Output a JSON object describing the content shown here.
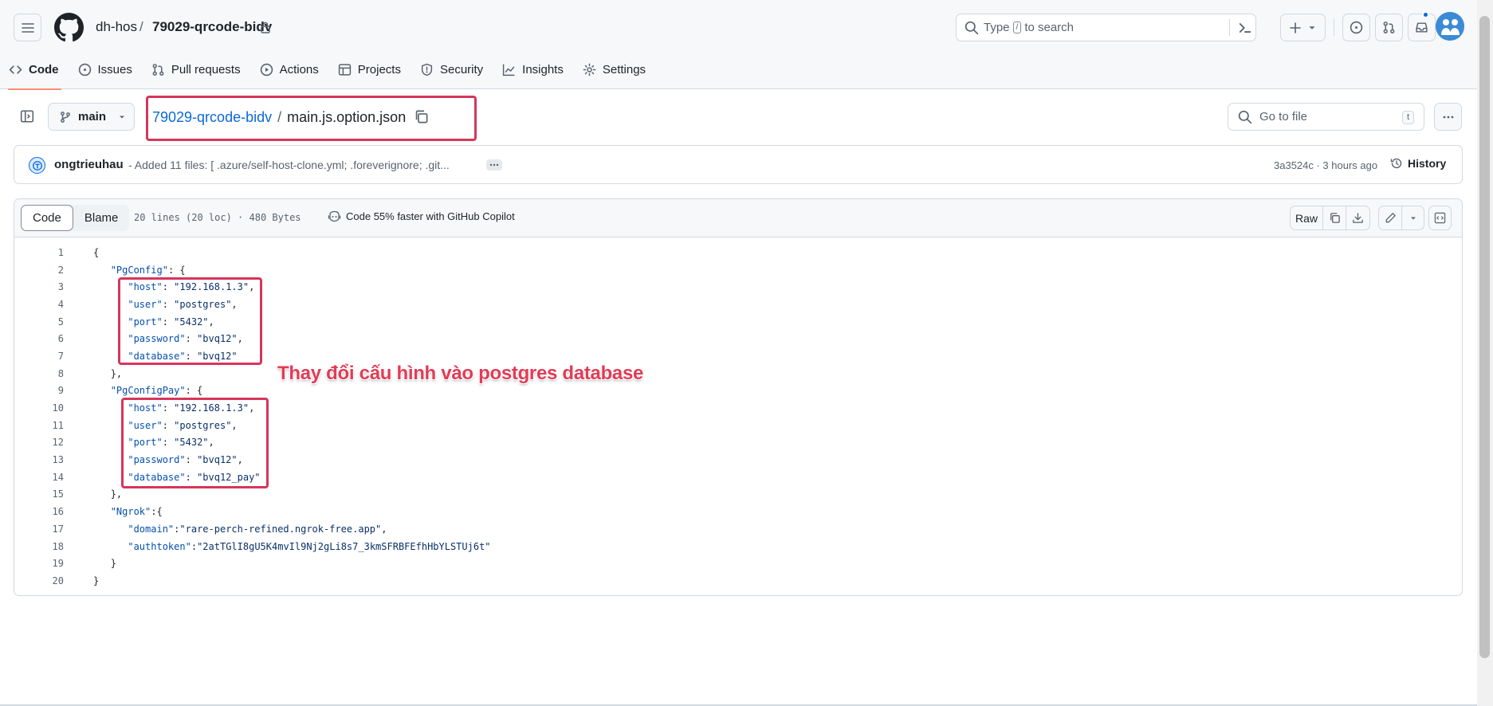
{
  "header": {
    "owner": "dh-hos",
    "separator": "/",
    "repo": "79029-qrcode-bidv",
    "search_placeholder_before": "Type",
    "search_key": "/",
    "search_placeholder_after": "to search"
  },
  "nav": {
    "tabs": [
      {
        "label": "Code",
        "icon": "code-icon"
      },
      {
        "label": "Issues",
        "icon": "issue-icon"
      },
      {
        "label": "Pull requests",
        "icon": "pull-request-icon"
      },
      {
        "label": "Actions",
        "icon": "play-icon"
      },
      {
        "label": "Projects",
        "icon": "table-icon"
      },
      {
        "label": "Security",
        "icon": "shield-icon"
      },
      {
        "label": "Insights",
        "icon": "graph-icon"
      },
      {
        "label": "Settings",
        "icon": "gear-icon"
      }
    ],
    "active": "Code"
  },
  "file": {
    "branch": "main",
    "path_repo": "79029-qrcode-bidv",
    "path_sep": "/",
    "filename": "main.js.option.json",
    "goto_placeholder": "Go to file",
    "goto_key": "t"
  },
  "commit": {
    "author": "ongtrieuhau",
    "message": "- Added 11 files: [ .azure/self-host-clone.yml; .foreverignore; .git...",
    "meta": "3a3524c · 3 hours ago",
    "history_label": "History"
  },
  "code_toolbar": {
    "tab_code": "Code",
    "tab_blame": "Blame",
    "stats": "20 lines (20 loc) · 480 Bytes",
    "copilot": "Code 55% faster with GitHub Copilot",
    "raw_label": "Raw"
  },
  "code": {
    "lines": [
      {
        "n": "1",
        "indent": "",
        "parts": [
          {
            "t": "{",
            "c": ""
          }
        ]
      },
      {
        "n": "2",
        "indent": "   ",
        "parts": [
          {
            "t": "\"PgConfig\"",
            "c": "k"
          },
          {
            "t": ": {",
            "c": ""
          }
        ]
      },
      {
        "n": "3",
        "indent": "      ",
        "parts": [
          {
            "t": "\"host\"",
            "c": "k"
          },
          {
            "t": ": ",
            "c": ""
          },
          {
            "t": "\"192.168.1.3\"",
            "c": "s"
          },
          {
            "t": ",",
            "c": ""
          }
        ]
      },
      {
        "n": "4",
        "indent": "      ",
        "parts": [
          {
            "t": "\"user\"",
            "c": "k"
          },
          {
            "t": ": ",
            "c": ""
          },
          {
            "t": "\"postgres\"",
            "c": "s"
          },
          {
            "t": ",",
            "c": ""
          }
        ]
      },
      {
        "n": "5",
        "indent": "      ",
        "parts": [
          {
            "t": "\"port\"",
            "c": "k"
          },
          {
            "t": ": ",
            "c": ""
          },
          {
            "t": "\"5432\"",
            "c": "s"
          },
          {
            "t": ",",
            "c": ""
          }
        ]
      },
      {
        "n": "6",
        "indent": "      ",
        "parts": [
          {
            "t": "\"password\"",
            "c": "k"
          },
          {
            "t": ": ",
            "c": ""
          },
          {
            "t": "\"bvq12\"",
            "c": "s"
          },
          {
            "t": ",",
            "c": ""
          }
        ]
      },
      {
        "n": "7",
        "indent": "      ",
        "parts": [
          {
            "t": "\"database\"",
            "c": "k"
          },
          {
            "t": ": ",
            "c": ""
          },
          {
            "t": "\"bvq12\"",
            "c": "s"
          }
        ]
      },
      {
        "n": "8",
        "indent": "   ",
        "parts": [
          {
            "t": "},",
            "c": ""
          }
        ]
      },
      {
        "n": "9",
        "indent": "   ",
        "parts": [
          {
            "t": "\"PgConfigPay\"",
            "c": "k"
          },
          {
            "t": ": {",
            "c": ""
          }
        ]
      },
      {
        "n": "10",
        "indent": "      ",
        "parts": [
          {
            "t": "\"host\"",
            "c": "k"
          },
          {
            "t": ": ",
            "c": ""
          },
          {
            "t": "\"192.168.1.3\"",
            "c": "s"
          },
          {
            "t": ",",
            "c": ""
          }
        ]
      },
      {
        "n": "11",
        "indent": "      ",
        "parts": [
          {
            "t": "\"user\"",
            "c": "k"
          },
          {
            "t": ": ",
            "c": ""
          },
          {
            "t": "\"postgres\"",
            "c": "s"
          },
          {
            "t": ",",
            "c": ""
          }
        ]
      },
      {
        "n": "12",
        "indent": "      ",
        "parts": [
          {
            "t": "\"port\"",
            "c": "k"
          },
          {
            "t": ": ",
            "c": ""
          },
          {
            "t": "\"5432\"",
            "c": "s"
          },
          {
            "t": ",",
            "c": ""
          }
        ]
      },
      {
        "n": "13",
        "indent": "      ",
        "parts": [
          {
            "t": "\"password\"",
            "c": "k"
          },
          {
            "t": ": ",
            "c": ""
          },
          {
            "t": "\"bvq12\"",
            "c": "s"
          },
          {
            "t": ",",
            "c": ""
          }
        ]
      },
      {
        "n": "14",
        "indent": "      ",
        "parts": [
          {
            "t": "\"database\"",
            "c": "k"
          },
          {
            "t": ": ",
            "c": ""
          },
          {
            "t": "\"bvq12_pay\"",
            "c": "s"
          }
        ]
      },
      {
        "n": "15",
        "indent": "   ",
        "parts": [
          {
            "t": "},",
            "c": ""
          }
        ]
      },
      {
        "n": "16",
        "indent": "   ",
        "parts": [
          {
            "t": "\"Ngrok\"",
            "c": "k"
          },
          {
            "t": ":{",
            "c": ""
          }
        ]
      },
      {
        "n": "17",
        "indent": "      ",
        "parts": [
          {
            "t": "\"domain\"",
            "c": "k"
          },
          {
            "t": ":",
            "c": ""
          },
          {
            "t": "\"rare-perch-refined.ngrok-free.app\"",
            "c": "s"
          },
          {
            "t": ",",
            "c": ""
          }
        ]
      },
      {
        "n": "18",
        "indent": "      ",
        "parts": [
          {
            "t": "\"authtoken\"",
            "c": "k"
          },
          {
            "t": ":",
            "c": ""
          },
          {
            "t": "\"2atTGlI8gU5K4mvIl9Nj2gLi8s7_3kmSFRBFEfhHbYLSTUj6t\"",
            "c": "s"
          }
        ]
      },
      {
        "n": "19",
        "indent": "   ",
        "parts": [
          {
            "t": "}",
            "c": ""
          }
        ]
      },
      {
        "n": "20",
        "indent": "",
        "parts": [
          {
            "t": "}",
            "c": ""
          }
        ]
      }
    ]
  },
  "annotation": {
    "text": "Thay đổi cấu hình vào postgres database",
    "color": "#e23b56"
  },
  "colors": {
    "accent": "#0969da",
    "highlight_box": "#d6365c",
    "active_tab_underline": "#fd8c73"
  }
}
